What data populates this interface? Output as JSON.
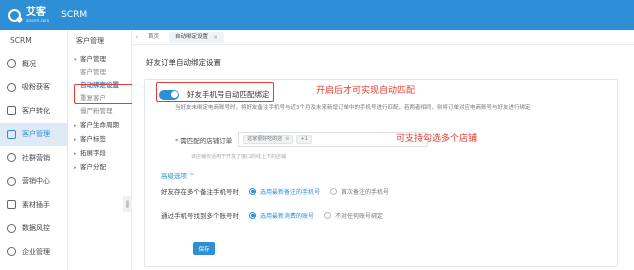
{
  "header": {
    "logo_text": "艾客",
    "logo_subtext": "aiscrm.com",
    "app_name": "SCRM"
  },
  "sidebar": {
    "title": "SCRM",
    "items": [
      {
        "label": "概况",
        "icon": "overview-icon"
      },
      {
        "label": "吸粉获客",
        "icon": "acquire-icon"
      },
      {
        "label": "客户转化",
        "icon": "convert-icon"
      },
      {
        "label": "客户管理",
        "icon": "customer-icon",
        "active": true
      },
      {
        "label": "社群营销",
        "icon": "community-icon"
      },
      {
        "label": "营销中心",
        "icon": "marketing-icon"
      },
      {
        "label": "素材插手",
        "icon": "material-icon"
      },
      {
        "label": "数据风控",
        "icon": "data-icon"
      },
      {
        "label": "企业管理",
        "icon": "enterprise-icon"
      }
    ]
  },
  "subnav": {
    "head": "客户管理",
    "entries": [
      {
        "type": "group",
        "label": "客户管理"
      },
      {
        "type": "item",
        "label": "客户管理"
      },
      {
        "type": "item",
        "label": "自动绑定设置",
        "active": true
      },
      {
        "type": "item",
        "label": "重复客户"
      },
      {
        "type": "item",
        "label": "僵尸粉管理"
      },
      {
        "type": "group",
        "label": "客户生命周期"
      },
      {
        "type": "group",
        "label": "客户标签"
      },
      {
        "type": "group",
        "label": "拓展字段"
      },
      {
        "type": "group",
        "label": "客户分配"
      }
    ]
  },
  "tabs": [
    {
      "label": "首页"
    },
    {
      "label": "自动绑定设置",
      "active": true
    }
  ],
  "main": {
    "page_title": "好友订单自动绑定设置",
    "toggle_label": "好友手机号自动匹配绑定",
    "toggle_on": true,
    "annotation_1": "开启后才可实现自动匹配",
    "annotation_2": "可支持勾选多个店铺",
    "description": "当好友未绑定电商账号时，将好友备注手机号与近3个月及未来新增订单中的手机号进行匹配，若两者相同，则将订单对应电商账号与好友进行绑定",
    "store_label": "需匹配的店铺订单",
    "store_tag": "这家很好吃的店",
    "store_more": "+1",
    "store_hint": "该店铺仅适用于开发了接口的线上下的店铺",
    "advanced_label": "高级选项",
    "opt1_label": "好友存在多个备注手机号时",
    "opt1_choices": [
      "选用最新备注的手机号",
      "首次备注的手机号"
    ],
    "opt1_selected": 0,
    "opt2_label": "通过手机号找到多个账号时",
    "opt2_choices": [
      "选用最新消费的账号",
      "不对任何账号绑定"
    ],
    "opt2_selected": 0,
    "save_label": "保存"
  },
  "colors": {
    "primary": "#2f8fd6",
    "annotation": "#e63b2e"
  }
}
